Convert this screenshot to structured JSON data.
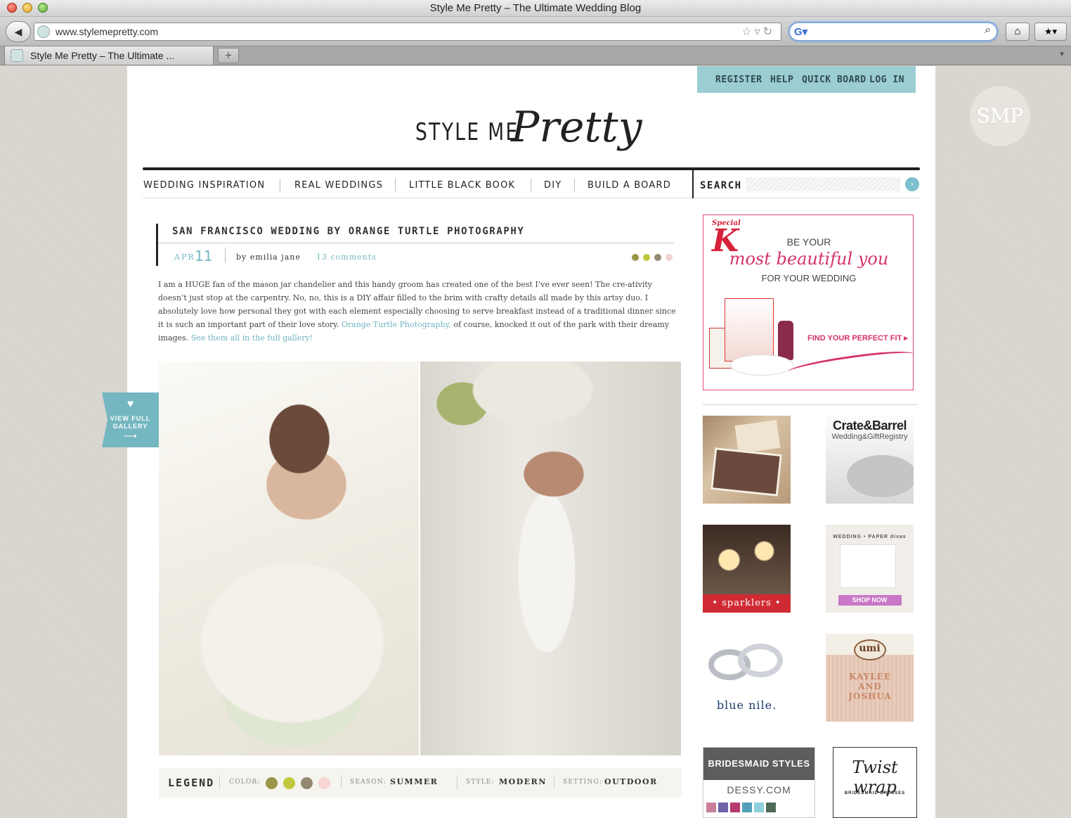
{
  "browser": {
    "window_title": "Style Me Pretty – The Ultimate Wedding Blog",
    "url": "www.stylemepretty.com",
    "tab_title": "Style Me Pretty – The Ultimate ...",
    "back_glyph": "◀",
    "url_icons": "☆▿↻",
    "search_engine_glyph": "G▾",
    "search_glyph": "⌕",
    "home_glyph": "⌂",
    "bookmarks_glyph": "★▾",
    "newtab_glyph": "+",
    "tab_overflow_glyph": "▼",
    "search_value": ""
  },
  "site": {
    "badge": "SMP",
    "top_nav": [
      "REGISTER",
      "HELP",
      "QUICK BOARD",
      "LOG IN"
    ],
    "logo_part1": "STYLE ME",
    "logo_part2": "Pretty",
    "main_nav": [
      "WEDDING INSPIRATION",
      "REAL WEDDINGS",
      "LITTLE BLACK BOOK",
      "DIY",
      "BUILD A BOARD"
    ],
    "search_label": "SEARCH",
    "search_go_glyph": "›",
    "search_value": ""
  },
  "post": {
    "title": "SAN FRANCISCO WEDDING BY ORANGE TURTLE PHOTOGRAPHY",
    "month": "APR",
    "day": "11",
    "author": "by emilia jane",
    "comments": "13 comments",
    "swatch_colors": [
      "#9a9548",
      "#bfc83a",
      "#948873",
      "#f3d3cf"
    ],
    "body_part1": "I am a HUGE fan of the mason jar chandelier and this handy groom has created one of the best I’ve ever seen!  The cre-ativity doesn’t just stop at the carpentry.  No, no, this is a DIY affair filled to the brim with crafty details all made by this artsy duo.  I absolutely love how personal they got with each element especially choosing to serve breakfast instead of a traditional dinner since it is such an important part of their love story.",
    "body_link1": "Orange Turtle Photography,",
    "body_part2": " of course, knocked it out of the park with their dreamy images.",
    "body_link2": "See them all in the full gallery!",
    "gallery_tab": {
      "heart": "♥",
      "line1": "VIEW FULL",
      "line2": "GALLERY",
      "arrow": "⟶"
    }
  },
  "legend": {
    "title": "LEGEND",
    "color_key": "COLOR:",
    "colors": [
      "#9a9548",
      "#bfc83a",
      "#948873",
      "#f6d5d2"
    ],
    "season_key": "SEASON:",
    "season": "SUMMER",
    "style_key": "STYLE:",
    "style": "MODERN",
    "setting_key": "SETTING:",
    "setting": "OUTDOOR"
  },
  "sidebar": {
    "ad": {
      "brand_small": "Special",
      "brand_big": "K",
      "line1": "BE YOUR",
      "line2": "most beautiful you",
      "line3": "FOR YOUR WEDDING",
      "cta": "FIND YOUR PERFECT FIT ▸"
    },
    "thumbs": {
      "crate_line1": "Crate&Barrel",
      "crate_line2": "Wedding&GiftRegistry",
      "sparklers": "• sparklers •",
      "divas_head": "WEDDING • PAPER divas",
      "divas_btn": "SHOP NOW",
      "bluenile": "blue nile.",
      "umi": "umi",
      "umi_names": "KAYLEE AND JOSHUA"
    },
    "bridesmaid": {
      "head": "BRIDESMAID STYLES",
      "site": "DESSY.COM",
      "swatches": [
        "#c77f9c",
        "#6c63a8",
        "#b53a70",
        "#52a0b7",
        "#8fd0dc",
        "#4f6b5a"
      ]
    },
    "twist": {
      "line1": "Twist wrap",
      "line2": "BRIDESMAID DRESSES"
    }
  }
}
